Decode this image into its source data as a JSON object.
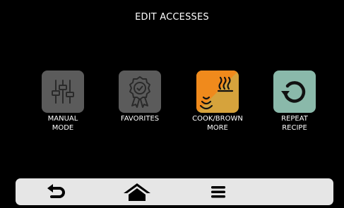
{
  "header": {
    "title": "EDIT ACCESSES"
  },
  "tiles": [
    {
      "line1": "MANUAL",
      "line2": "MODE",
      "icon": "sliders-icon",
      "bg": "#5b5b5b"
    },
    {
      "line1": "FAVORITES",
      "line2": "",
      "icon": "award-ribbon-icon",
      "bg": "#5b5b5b"
    },
    {
      "line1": "COOK/BROWN",
      "line2": "MORE",
      "icon": "cook-brown-icon",
      "bg_a": "#f08a1c",
      "bg_b": "#d6a33c"
    },
    {
      "line1": "REPEAT",
      "line2": "RECIPE",
      "icon": "repeat-icon",
      "bg": "#8ab9aa"
    }
  ],
  "navbar": {
    "items": [
      "back-arrow-icon",
      "home-icon",
      "menu-icon"
    ]
  },
  "colors": {
    "background": "#000000",
    "navbar": "#e6e6e6",
    "text": "#ffffff"
  }
}
